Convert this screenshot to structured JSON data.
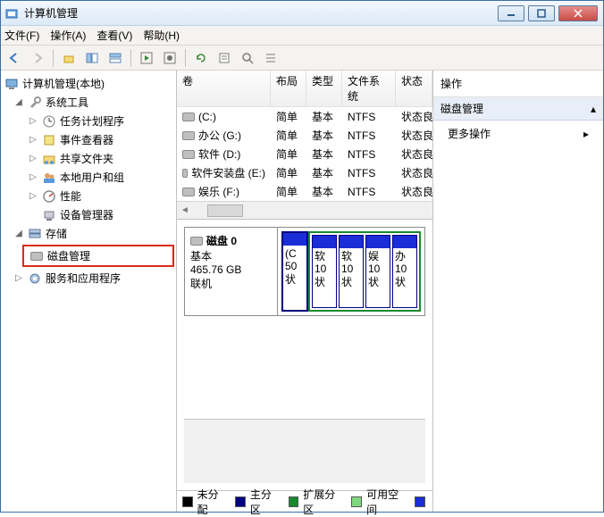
{
  "window": {
    "title": "计算机管理"
  },
  "menus": {
    "file": "文件(F)",
    "action": "操作(A)",
    "view": "查看(V)",
    "help": "帮助(H)"
  },
  "tree": {
    "root": "计算机管理(本地)",
    "sys_tools": "系统工具",
    "task_sched": "任务计划程序",
    "event_viewer": "事件查看器",
    "shared_folders": "共享文件夹",
    "local_users": "本地用户和组",
    "performance": "性能",
    "device_mgr": "设备管理器",
    "storage": "存储",
    "disk_mgmt": "磁盘管理",
    "services_apps": "服务和应用程序"
  },
  "volumes": {
    "headers": {
      "vol": "卷",
      "layout": "布局",
      "type": "类型",
      "fs": "文件系统",
      "status": "状态"
    },
    "rows": [
      {
        "name": "(C:)",
        "layout": "简单",
        "type": "基本",
        "fs": "NTFS",
        "status": "状态良"
      },
      {
        "name": "办公 (G:)",
        "layout": "简单",
        "type": "基本",
        "fs": "NTFS",
        "status": "状态良"
      },
      {
        "name": "软件 (D:)",
        "layout": "简单",
        "type": "基本",
        "fs": "NTFS",
        "status": "状态良"
      },
      {
        "name": "软件安装盘 (E:)",
        "layout": "简单",
        "type": "基本",
        "fs": "NTFS",
        "status": "状态良"
      },
      {
        "name": "娱乐 (F:)",
        "layout": "简单",
        "type": "基本",
        "fs": "NTFS",
        "status": "状态良"
      }
    ]
  },
  "disk": {
    "label": "磁盘 0",
    "type": "基本",
    "size": "465.76 GB",
    "status": "联机",
    "partitions": {
      "primary": {
        "l1": "(C",
        "l2": "50",
        "l3": "状"
      },
      "logical": [
        {
          "l1": "软",
          "l2": "10",
          "l3": "状"
        },
        {
          "l1": "软",
          "l2": "10",
          "l3": "状"
        },
        {
          "l1": "娱",
          "l2": "10",
          "l3": "状"
        },
        {
          "l1": "办",
          "l2": "10",
          "l3": "状"
        }
      ]
    }
  },
  "legend": {
    "unalloc": "未分配",
    "primary": "主分区",
    "ext": "扩展分区",
    "free": "可用空间"
  },
  "actions": {
    "header": "操作",
    "selected": "磁盘管理",
    "more": "更多操作"
  },
  "colors": {
    "primary": "#000080",
    "extended": "#188a2e",
    "free": "#7fd87f",
    "unalloc": "#000000",
    "blue_stripe": "#1a2dd6"
  }
}
